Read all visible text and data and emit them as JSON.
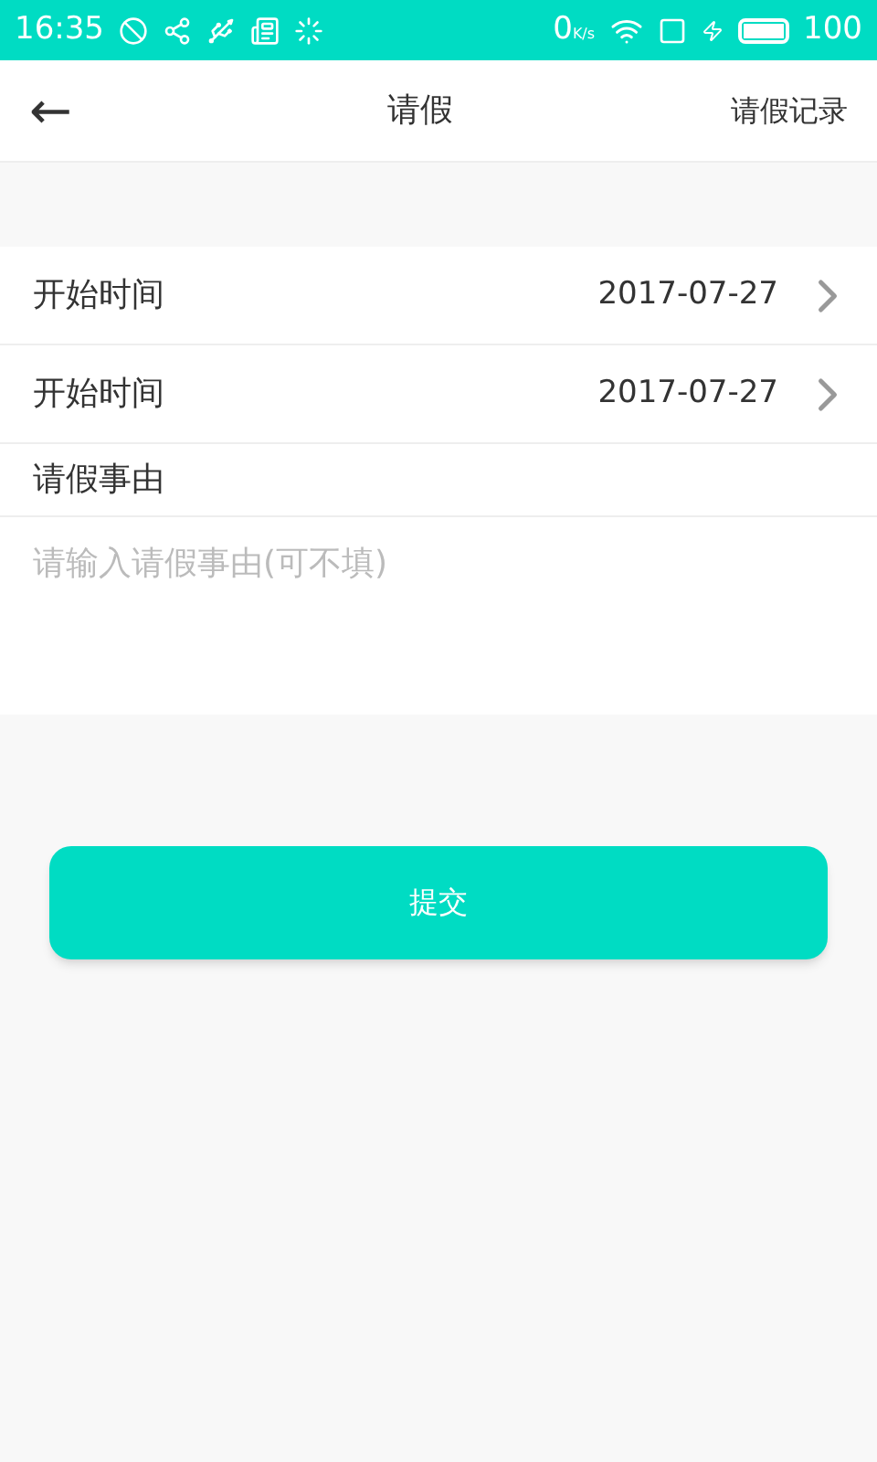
{
  "status_bar": {
    "time": "16:35",
    "speed": "0",
    "speed_unit": "K/s",
    "battery": "100"
  },
  "header": {
    "back": "←",
    "title": "请假",
    "action": "请假记录"
  },
  "rows": [
    {
      "label": "开始时间",
      "value": "2017-07-27"
    },
    {
      "label": "开始时间",
      "value": "2017-07-27"
    }
  ],
  "reason": {
    "label": "请假事由",
    "placeholder": "请输入请假事由(可不填)"
  },
  "submit": "提交"
}
